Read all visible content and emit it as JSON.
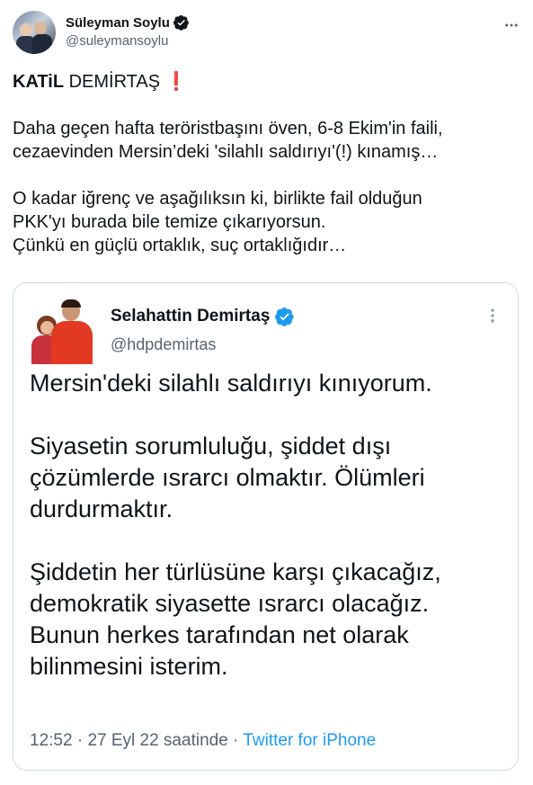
{
  "author": {
    "name": "Süleyman Soylu",
    "handle": "@suleymansoylu",
    "verified": true
  },
  "tweet": {
    "title_bold": "KATiL",
    "title_rest": " DEMİRTAŞ",
    "title_emoji": "❗",
    "paragraph1_line1": "Daha geçen hafta teröristbaşını öven, 6-8 Ekim'in faili,",
    "paragraph1_line2": "cezaevinden Mersin’deki 'silahlı saldırıyı'(!) kınamış…",
    "paragraph2_line1": "O kadar iğrenç ve aşağılıksın ki, birlikte fail olduğun",
    "paragraph2_line2": "PKK'yı burada bile temize çıkarıyorsun.",
    "paragraph2_line3": "Çünkü en güçlü ortaklık, suç ortaklığıdır…"
  },
  "quoted": {
    "name": "Selahattin Demirtaş",
    "handle": "@hdpdemirtas",
    "verified": true,
    "line1": "Mersin'deki silahlı saldırıyı kınıyorum.",
    "line2": "Siyasetin sorumluluğu, şiddet dışı",
    "line3": "çözümlerde ısrarcı olmaktır. Ölümleri",
    "line4": "durdurmaktır.",
    "line5": "Şiddetin her türlüsüne karşı çıkacağız,",
    "line6": "demokratik siyasette ısrarcı olacağız.",
    "line7": "Bunun herkes tarafından net olarak",
    "line8": "bilinmesini isterim.",
    "time": "12:52",
    "date": "27 Eyl 22 saatinde",
    "source": "Twitter for iPhone",
    "separator": " · "
  },
  "icons": {
    "verified": "verified-badge-icon",
    "more": "more-options-icon"
  },
  "colors": {
    "verified_blue": "#1d9bf0",
    "text": "#0f1419",
    "secondary": "#536471",
    "border": "#cfd9de",
    "alert_red": "#e0245e"
  }
}
